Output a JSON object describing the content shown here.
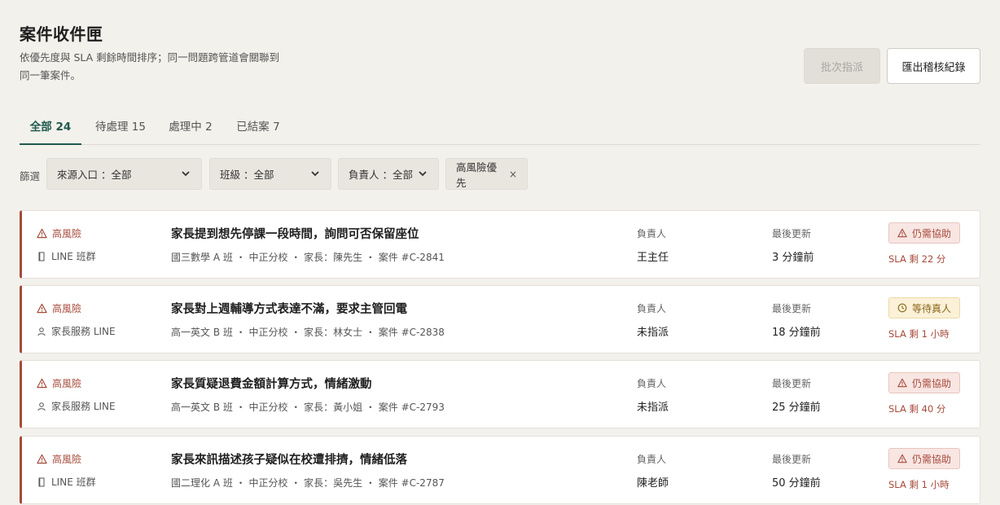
{
  "header": {
    "title": "案件收件匣",
    "subtitle_line1": "依優先度與 SLA 剩餘時間排序；同一問題跨管道會關聯到",
    "subtitle_line2": "同一筆案件。",
    "batch_assign_label": "批次指派",
    "export_label": "匯出稽核紀錄"
  },
  "tabs": [
    {
      "label": "全部 24",
      "active": true
    },
    {
      "label": "待處理 15",
      "active": false
    },
    {
      "label": "處理中 2",
      "active": false
    },
    {
      "label": "已結案 7",
      "active": false
    }
  ],
  "filters": {
    "label": "篩選",
    "source": "來源入口 ：全部",
    "class": "班級 ：全部",
    "owner": "負責人 ：全部",
    "high_risk": "高風險優先"
  },
  "cases": [
    {
      "risk": "高風險",
      "source": "LINE 班群",
      "source_icon": "book-icon",
      "title": "家長提到想先停課一段時間，詢問可否保留座位",
      "meta": "國三數學 A 班 ・ 中正分校 ・ 家長：陳先生 ・ 案件 #C-2841",
      "owner_label": "負責人",
      "owner": "王主任",
      "updated_label": "最後更新",
      "updated": "3 分鐘前",
      "status": "仍需協助",
      "status_type": "help",
      "sla": "SLA 剩 22 分"
    },
    {
      "risk": "高風險",
      "source": "家長服務 LINE",
      "source_icon": "person-icon",
      "title": "家長對上週輔導方式表達不滿，要求主管回電",
      "meta": "高一英文 B 班 ・ 中正分校 ・ 家長：林女士 ・ 案件 #C-2838",
      "owner_label": "負責人",
      "owner": "未指派",
      "updated_label": "最後更新",
      "updated": "18 分鐘前",
      "status": "等待真人",
      "status_type": "wait",
      "sla": "SLA 剩 1 小時"
    },
    {
      "risk": "高風險",
      "source": "家長服務 LINE",
      "source_icon": "person-icon",
      "title": "家長質疑退費金額計算方式，情緒激動",
      "meta": "高一英文 B 班 ・ 中正分校 ・ 家長：黃小姐 ・ 案件 #C-2793",
      "owner_label": "負責人",
      "owner": "未指派",
      "updated_label": "最後更新",
      "updated": "25 分鐘前",
      "status": "仍需協助",
      "status_type": "help",
      "sla": "SLA 剩 40 分"
    },
    {
      "risk": "高風險",
      "source": "LINE 班群",
      "source_icon": "book-icon",
      "title": "家長來訊描述孩子疑似在校遭排擠，情緒低落",
      "meta": "國二理化 A 班 ・ 中正分校 ・ 家長：吳先生 ・ 案件 #C-2787",
      "owner_label": "負責人",
      "owner": "陳老師",
      "updated_label": "最後更新",
      "updated": "50 分鐘前",
      "status": "仍需協助",
      "status_type": "help",
      "sla": "SLA 剩 1 小時"
    }
  ],
  "colors": {
    "accent": "#1f5a4d",
    "risk": "#a64a3a",
    "background": "#f3f1ec"
  }
}
